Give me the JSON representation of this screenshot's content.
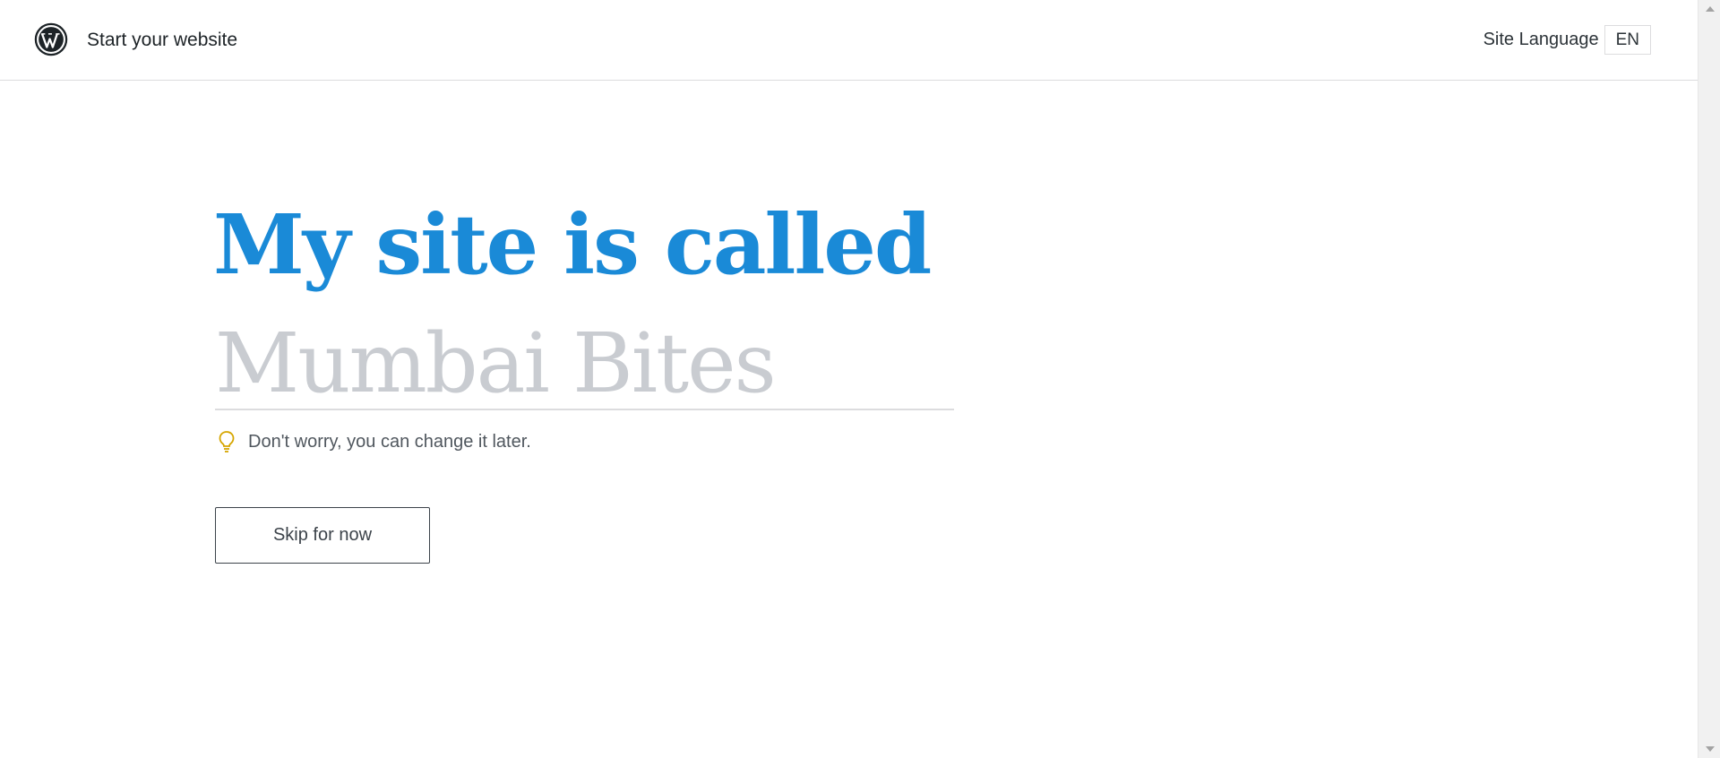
{
  "header": {
    "logo_icon": "wordpress-logo-icon",
    "title": "Start your website",
    "language_label": "Site Language",
    "language_value": "EN"
  },
  "main": {
    "headline": "My site is called",
    "site_name": {
      "value": "",
      "placeholder": "Mumbai Bites"
    },
    "hint_icon": "lightbulb-icon",
    "hint_text": "Don't worry, you can change it later.",
    "skip_label": "Skip for now"
  },
  "colors": {
    "accent": "#1a8ad7",
    "hint_icon": "#d6a600",
    "placeholder": "#c9ccd1"
  }
}
